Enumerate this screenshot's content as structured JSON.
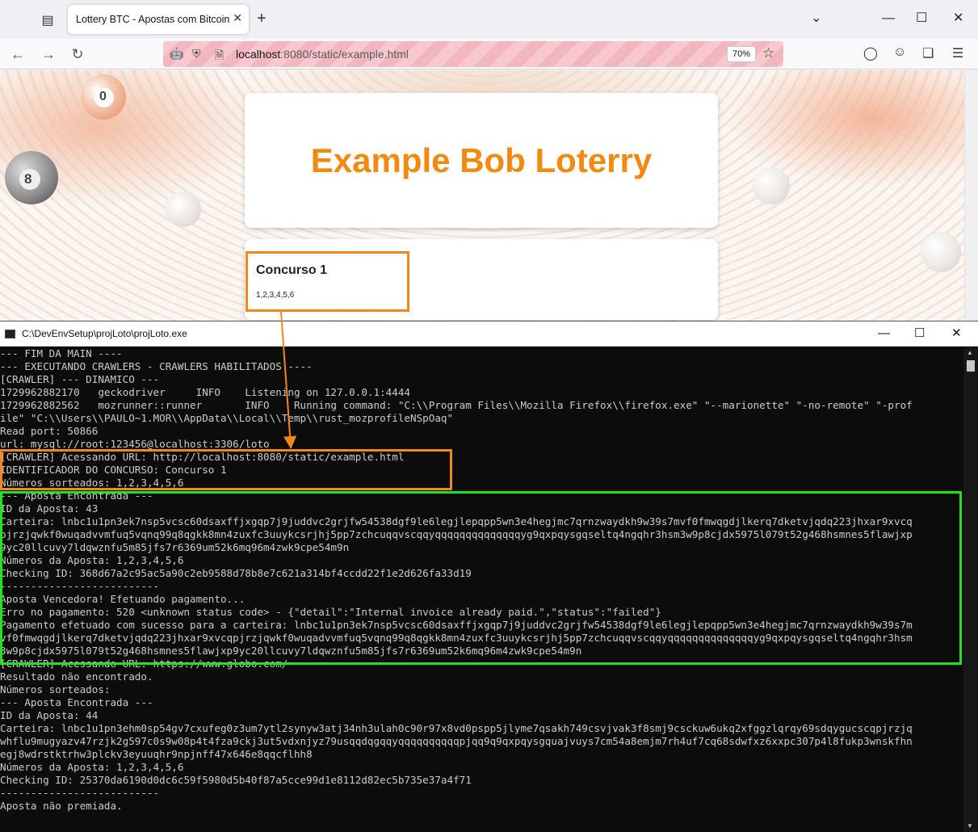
{
  "browser": {
    "tab_title": "Lottery BTC - Apostas com Bitcoin",
    "url_host": "localhost",
    "url_rest": ":8080/static/example.html",
    "zoom": "70%"
  },
  "page": {
    "title": "Example Bob Loterry",
    "contest_name": "Concurso 1",
    "contest_numbers": "1,2,3,4,5,6",
    "title_color": "#f28a12"
  },
  "console": {
    "title": "C:\\DevEnvSetup\\projLoto\\projLoto.exe",
    "lines": [
      "--- FIM DA MAIN ----",
      "--- EXECUTANDO CRAWLERS - CRAWLERS HABILITADOS ----",
      "[CRAWLER] --- DINAMICO ---",
      "1729962882170   geckodriver     INFO    Listening on 127.0.0.1:4444",
      "1729962882562   mozrunner::runner       INFO    Running command: \"C:\\\\Program Files\\\\Mozilla Firefox\\\\firefox.exe\" \"--marionette\" \"-no-remote\" \"-prof",
      "ile\" \"C:\\\\Users\\\\PAULO~1.MOR\\\\AppData\\\\Local\\\\Temp\\\\rust_mozprofileNSpOaq\"",
      "Read port: 50866",
      "url: mysql://root:123456@localhost:3306/loto",
      "[CRAWLER] Acessando URL: http://localhost:8080/static/example.html",
      "IDENTIFICADOR DO CONCURSO: Concurso 1",
      "Números sorteados: 1,2,3,4,5,6",
      "--- Aposta Encontrada ---",
      "ID da Aposta: 43",
      "Carteira: lnbc1u1pn3ek7nsp5vcsc60dsaxffjxgqp7j9juddvc2grjfw54538dgf9le6legjlepqpp5wn3e4hegjmc7qrnzwaydkh9w39s7mvf0fmwqgdjlkerq7dketvjqdq223jhxar9xvcq",
      "pjrzjqwkf0wuqadvvmfuq5vqnq99q8qgkk8mn4zuxfc3uuykcsrjhj5pp7zchcuqqvscqqyqqqqqqqqqqqqqqyg9qxpqysgqseltq4ngqhr3hsm3w9p8cjdx5975l079t52g468hsmnes5flawjxp",
      "9yc20llcuvy7ldqwznfu5m85jfs7r6369um52k6mq96m4zwk9cpe54m9n",
      "Números da Aposta: 1,2,3,4,5,6",
      "Checking ID: 368d67a2c95ac5a90c2eb9588d78b8e7c621a314bf4ccdd22f1e2d626fa33d19",
      "--------------------------",
      "Aposta Vencedora! Efetuando pagamento...",
      "Erro no pagamento: 520 <unknown status code> - {\"detail\":\"Internal invoice already paid.\",\"status\":\"failed\"}",
      "Pagamento efetuado com sucesso para a carteira: lnbc1u1pn3ek7nsp5vcsc60dsaxffjxgqp7j9juddvc2grjfw54538dgf9le6legjlepqpp5wn3e4hegjmc7qrnzwaydkh9w39s7m",
      "vf0fmwqgdjlkerq7dketvjqdq223jhxar9xvcqpjrzjqwkf0wuqadvvmfuq5vqnq99q8qgkk8mn4zuxfc3uuykcsrjhj5pp7zchcuqqvscqqyqqqqqqqqqqqqqqyg9qxpqysgqseltq4ngqhr3hsm",
      "3w9p8cjdx5975l079t52g468hsmnes5flawjxp9yc20llcuvy7ldqwznfu5m85jfs7r6369um52k6mq96m4zwk9cpe54m9n",
      "[CRAWLER] Acessando URL: https://www.globo.com/",
      "Resultado não encontrado.",
      "Números sorteados:",
      "--- Aposta Encontrada ---",
      "ID da Aposta: 44",
      "Carteira: lnbc1u1pn3ehm0sp54gv7cxufeg0z3um7ytl2synyw3atj34nh3ulah0c90r97x8vd0pspp5jlyme7qsakh749csvjvak3f8smj9csckuw6ukq2xfggzlqrqy69sdqygucscqpjrzjq",
      "whflu9mugyazv47rzjk2g597c0s9w08p4t4fza9ckj3ut5vdxnjyz79usqqdqgqqyqqqqqqqqqqpjqq9q9qxpqysgquajvuys7cm54a8emjm7rh4uf7cq68sdwfxz6xxpc307p4l8fukp3wnskfhn",
      "egj8wdrstktrhw3plckv3eyuuqhr9npjnff47x646e8qqcflhh8",
      "Números da Aposta: 1,2,3,4,5,6",
      "Checking ID: 25370da6190d0dc6c59f5980d5b40f87a5cce99d1e8112d82ec5b735e37a4f71",
      "--------------------------",
      "Aposta não premiada.",
      ""
    ]
  },
  "colors": {
    "highlight_orange": "#f2881a",
    "highlight_green": "#22e222"
  }
}
